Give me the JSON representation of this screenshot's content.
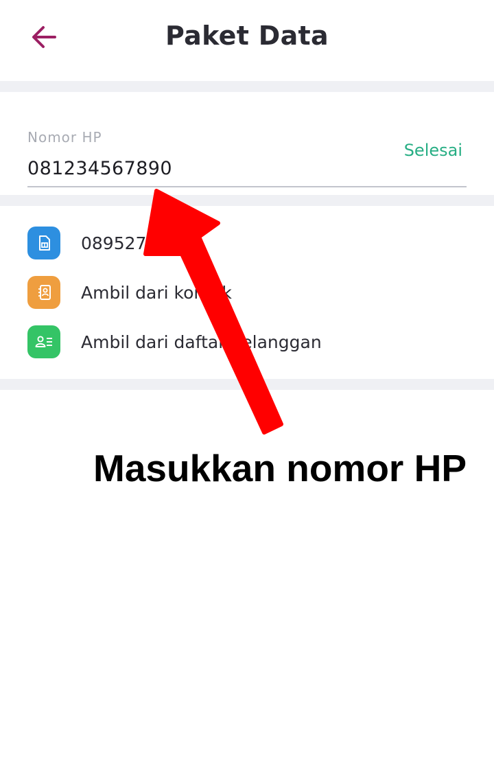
{
  "header": {
    "title": "Paket Data",
    "back_icon": "arrow-left-icon"
  },
  "phone_field": {
    "label": "Nomor HP",
    "value": "081234567890",
    "action_label": "Selesai"
  },
  "options": [
    {
      "label": "0895272",
      "icon": "sim-card-icon",
      "color": "#2d8fe0"
    },
    {
      "label": "Ambil dari kontak",
      "icon": "contact-book-icon",
      "color": "#ef9e3f"
    },
    {
      "label": "Ambil dari daftar pelanggan",
      "icon": "customer-list-icon",
      "color": "#34c466"
    }
  ],
  "annotation": {
    "text": "Masukkan nomor HP",
    "arrow_color": "#ff0000"
  },
  "colors": {
    "accent": "#9c1f63",
    "action": "#27ae84",
    "divider": "#eff0f4"
  }
}
